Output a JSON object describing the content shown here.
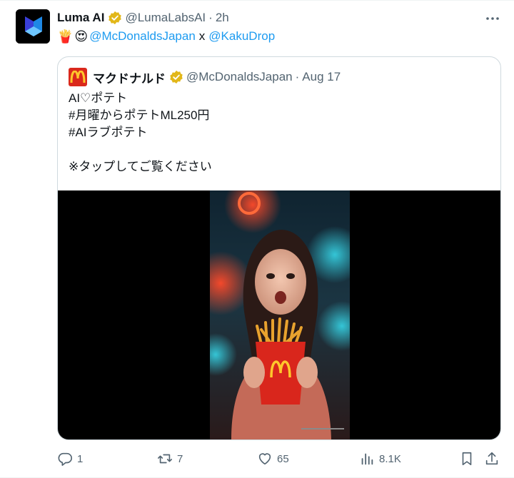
{
  "tweet": {
    "author_name": "Luma AI",
    "author_handle": "@LumaLabsAI",
    "separator_dot": "·",
    "time": "2h",
    "body": {
      "emojis": [
        "🍟",
        "😍"
      ],
      "mention_1": "@McDonaldsJapan",
      "separator": "x",
      "mention_2": "@KakuDrop"
    }
  },
  "quote": {
    "author_name": "マクドナルド",
    "author_handle": "@McDonaldsJapan",
    "separator_dot": "·",
    "date": "Aug 17",
    "lines": [
      "AI♡ポテト",
      "#月曜からポテトML250円",
      "#AIラブポテト",
      "",
      "※タップしてご覧ください"
    ]
  },
  "actions": {
    "replies": "1",
    "reposts": "7",
    "likes": "65",
    "views": "8.1K"
  },
  "colors": {
    "accent": "#1d9bf0",
    "muted": "#536471",
    "verified_gold": "#e2b719",
    "mcd_red": "#da291c",
    "mcd_yellow": "#ffc72c"
  },
  "icons": [
    "luma-logo-icon",
    "verified-icon",
    "more-icon",
    "mcdonalds-logo-icon",
    "reply-icon",
    "repost-icon",
    "like-icon",
    "views-icon",
    "bookmark-icon",
    "share-icon"
  ]
}
